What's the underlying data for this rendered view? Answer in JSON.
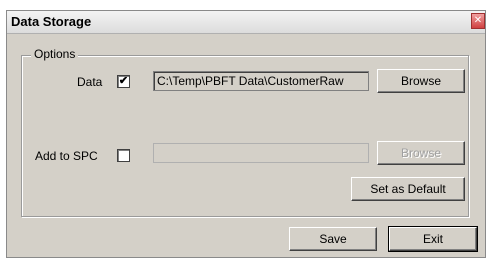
{
  "window": {
    "title": "Data Storage",
    "close_icon": "close-icon"
  },
  "options": {
    "group_label": "Options",
    "data": {
      "label": "Data",
      "checked": true,
      "path": "C:\\Temp\\PBFT Data\\CustomerRaw",
      "browse_label": "Browse"
    },
    "spc": {
      "label": "Add to SPC",
      "checked": false,
      "path": "",
      "browse_label": "Browse"
    },
    "set_default_label": "Set as Default"
  },
  "footer": {
    "save_label": "Save",
    "exit_label": "Exit"
  }
}
